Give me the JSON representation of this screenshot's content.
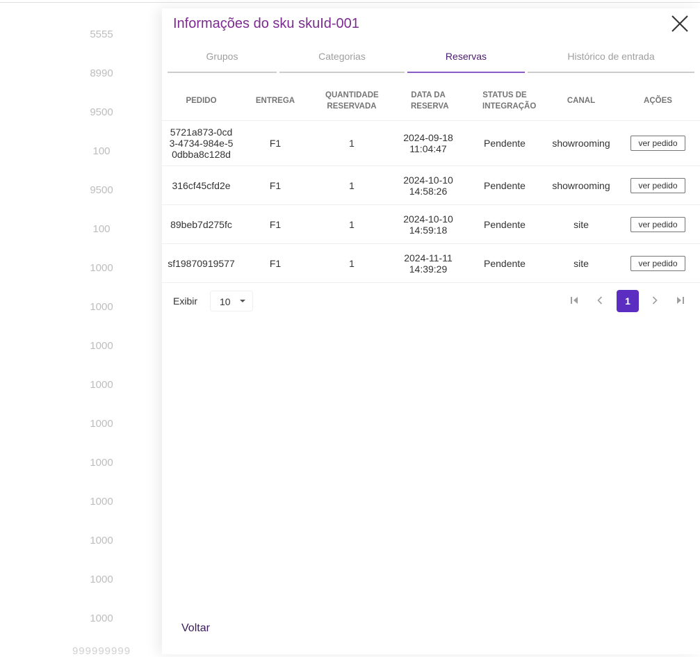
{
  "background": {
    "values": [
      "5555",
      "8990",
      "9500",
      "100",
      "9500",
      "100",
      "1000",
      "1000",
      "1000",
      "1000",
      "1000",
      "1000",
      "1000",
      "1000",
      "1000",
      "1000"
    ],
    "last_value": "999999999"
  },
  "drawer": {
    "title": "Informações do sku skuId-001",
    "tabs": [
      {
        "label": "Grupos",
        "active": false
      },
      {
        "label": "Categorias",
        "active": false
      },
      {
        "label": "Reservas",
        "active": true
      },
      {
        "label": "Histórico de entrada",
        "active": false
      }
    ],
    "table": {
      "headers": [
        "PEDIDO",
        "ENTREGA",
        "QUANTIDADE RESERVADA",
        "DATA DA RESERVA",
        "STATUS DE INTEGRAÇÃO",
        "CANAL",
        "AÇÕES"
      ],
      "rows": [
        {
          "pedido": "5721a873-0cd3-4734-984e-50dbba8c128d",
          "entrega": "F1",
          "quantidade": "1",
          "data": "2024-09-18 11:04:47",
          "status": "Pendente",
          "canal": "showrooming",
          "acao": "ver pedido"
        },
        {
          "pedido": "316cf45cfd2e",
          "entrega": "F1",
          "quantidade": "1",
          "data": "2024-10-10 14:58:26",
          "status": "Pendente",
          "canal": "showrooming",
          "acao": "ver pedido"
        },
        {
          "pedido": "89beb7d275fc",
          "entrega": "F1",
          "quantidade": "1",
          "data": "2024-10-10 14:59:18",
          "status": "Pendente",
          "canal": "site",
          "acao": "ver pedido"
        },
        {
          "pedido": "sf19870919577",
          "entrega": "F1",
          "quantidade": "1",
          "data": "2024-11-11 14:39:29",
          "status": "Pendente",
          "canal": "site",
          "acao": "ver pedido"
        }
      ]
    },
    "pagination": {
      "show_label": "Exibir",
      "page_size": "10",
      "current_page": "1"
    },
    "back_label": "Voltar"
  },
  "colors": {
    "title": "#7b2b8f",
    "active_tab_indicator": "#8e5bc6",
    "current_page_bg": "#5b2dc0"
  },
  "icons": [
    "close-icon",
    "first-page-icon",
    "chevron-left-icon",
    "chevron-right-icon",
    "last-page-icon",
    "caret-down-icon"
  ]
}
